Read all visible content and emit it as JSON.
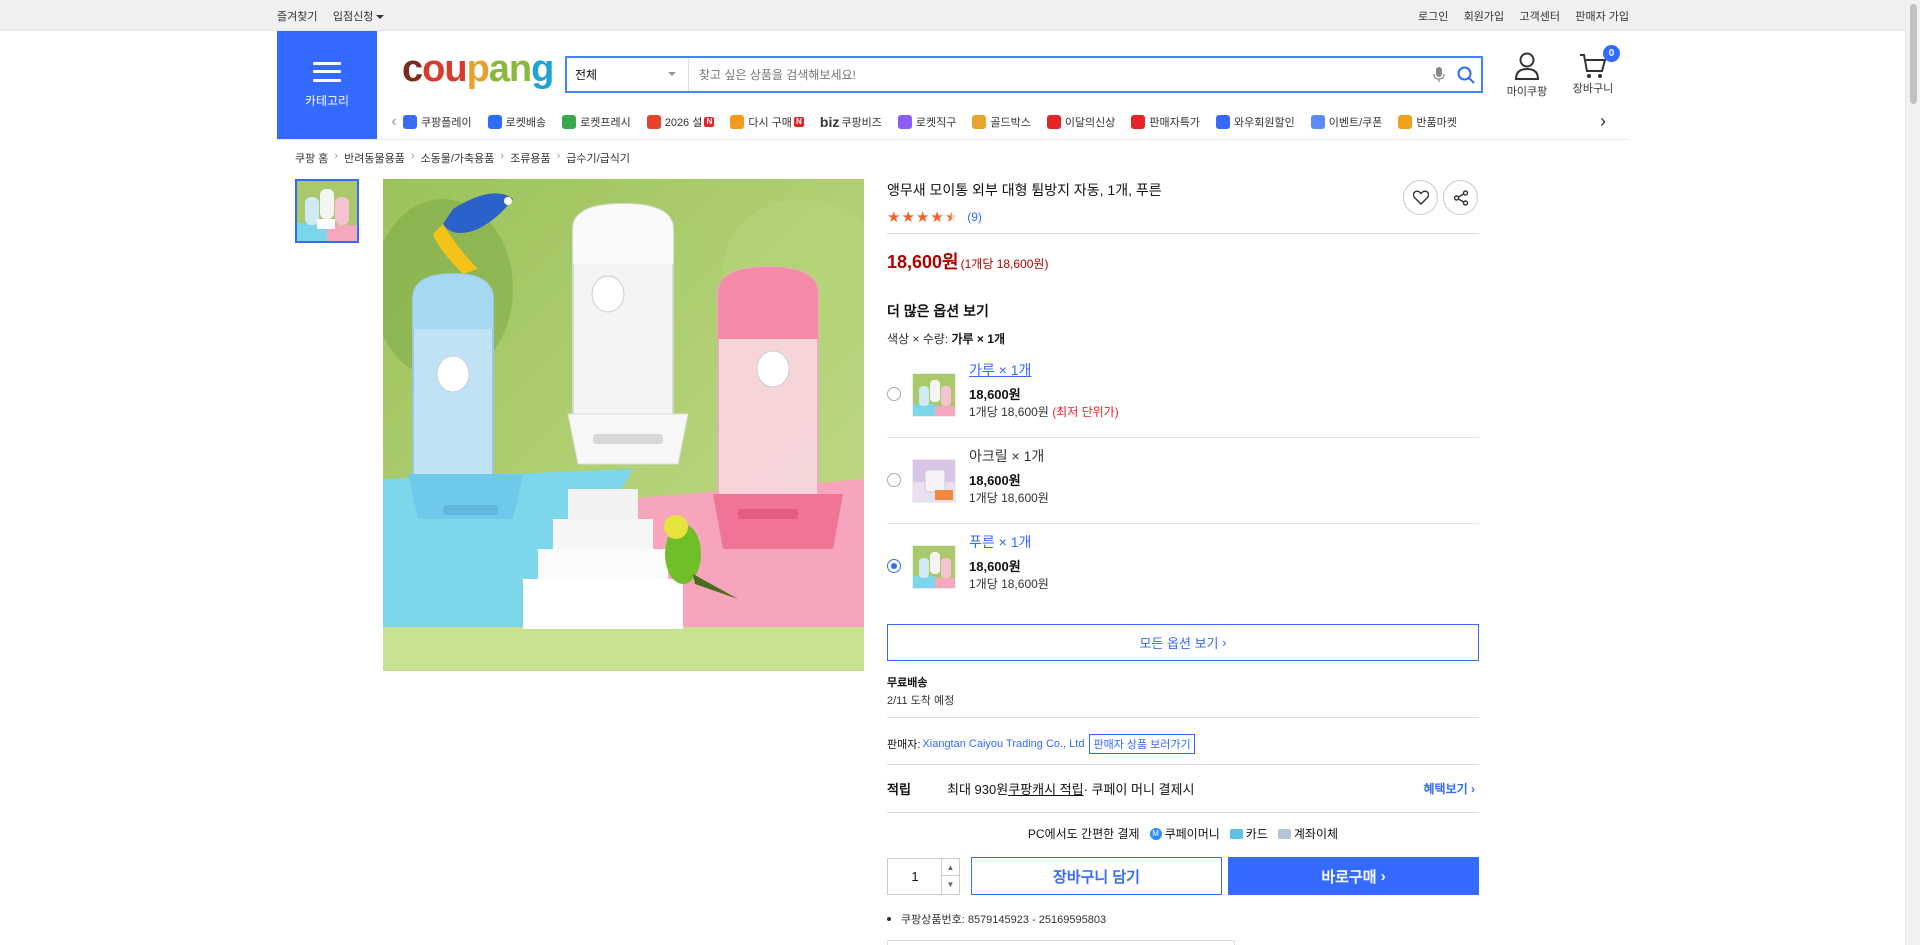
{
  "topbar": {
    "favorites": "즐겨찾기",
    "partner": "입점신청",
    "login": "로그인",
    "signup": "회원가입",
    "support": "고객센터",
    "seller_signup": "판매자 가입"
  },
  "header": {
    "category_label": "카테고리",
    "logo": [
      "c",
      "ou",
      "p",
      "an",
      "g"
    ],
    "search_category": "전체",
    "search_placeholder": "찾고 싶은 상품을 검색해보세요!",
    "mycoupang": "마이쿠팡",
    "cart": "장바구니",
    "cart_count": "0",
    "brand_color": "#346aff"
  },
  "shortcuts": [
    {
      "label": "쿠팡플레이",
      "icon_color": "#3b6cf6",
      "badge": ""
    },
    {
      "label": "로켓배송",
      "icon_color": "#2b6ef5",
      "badge": ""
    },
    {
      "label": "로켓프레시",
      "icon_color": "#38a84a",
      "badge": ""
    },
    {
      "label": "2026 설",
      "icon_color": "#e4442b",
      "badge": "N"
    },
    {
      "label": "다시 구매",
      "icon_color": "#f29b1d",
      "badge": "N"
    },
    {
      "label": "쿠팡비즈",
      "icon_color": "#222222",
      "badge": "",
      "prefix": "biz"
    },
    {
      "label": "로켓직구",
      "icon_color": "#8b5cf6",
      "badge": ""
    },
    {
      "label": "골드박스",
      "icon_color": "#e8a52d",
      "badge": ""
    },
    {
      "label": "이달의신상",
      "icon_color": "#e5242a",
      "badge": ""
    },
    {
      "label": "판매자특가",
      "icon_color": "#e5242a",
      "badge": ""
    },
    {
      "label": "와우회원할인",
      "icon_color": "#346aff",
      "badge": ""
    },
    {
      "label": "이벤트/쿠폰",
      "icon_color": "#5b8bf6",
      "badge": ""
    },
    {
      "label": "반품마켓",
      "icon_color": "#f0a21a",
      "badge": ""
    }
  ],
  "breadcrumb": [
    "쿠팡 홈",
    "반려동물용품",
    "소동물/가축용품",
    "조류용품",
    "급수기/급식기"
  ],
  "product": {
    "title": "앵무새 모이통 외부 대형 튐방지 자동, 1개, 푸른",
    "rating": 4.5,
    "review_count": "(9)",
    "price": "18,600원",
    "unit_price": "(1개당 18,600원)",
    "more_options": "더 많은 옵션 보기",
    "current_option_label": "색상 × 수량: ",
    "current_option_value": "가루 × 1개",
    "options": [
      {
        "name": "가루 × 1개",
        "price": "18,600원",
        "unit": "1개당 18,600원",
        "lowest": "(최저 단위가)",
        "selected": false
      },
      {
        "name": "아크릴 × 1개",
        "price": "18,600원",
        "unit": "1개당 18,600원",
        "lowest": "",
        "selected": false
      },
      {
        "name": "푸른 × 1개",
        "price": "18,600원",
        "unit": "1개당 18,600원",
        "lowest": "",
        "selected": true
      }
    ],
    "all_options": "모든 옵션 보기",
    "shipping_title": "무료배송",
    "shipping_date": "2/11 도착 예정",
    "seller_label": "판매자:",
    "seller_name": "Xiangtan Caiyou Trading Co., Ltd",
    "seller_button": "판매자 상품 보러가기",
    "reward_label": "적립",
    "reward_text_1": "최대 930원 ",
    "reward_link": "쿠팡캐시 적립",
    "reward_text_2": " · 쿠페이 머니 결제시",
    "benefit": "혜택보기 ›",
    "pay_title": "PC에서도 간편한 결제",
    "pay_methods": [
      "쿠페이머니",
      "카드",
      "계좌이체"
    ],
    "quantity": "1",
    "cart_button": "장바구니 담기",
    "buy_button": "바로구매",
    "product_id": "쿠팡상품번호: 8579145923 - 25169595803"
  }
}
